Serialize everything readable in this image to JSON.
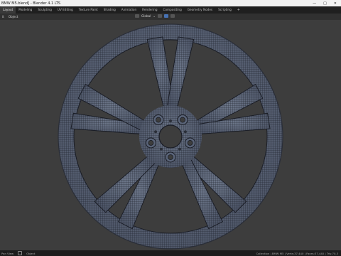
{
  "window": {
    "title": "BMW M5.blend] - Blender 4.1 LTS",
    "minimize": "—",
    "maximize": "□",
    "close": "✕"
  },
  "workspaces": {
    "tabs": [
      "Layout",
      "Modeling",
      "Sculpting",
      "UV Editing",
      "Texture Paint",
      "Shading",
      "Animation",
      "Rendering",
      "Compositing",
      "Geometry Nodes",
      "Scripting"
    ],
    "add": "+"
  },
  "scene": {
    "label": "Scene"
  },
  "header": {
    "menus": [
      "it",
      "Object"
    ],
    "transform": "Global",
    "pivot": "⌄"
  },
  "status": {
    "left": [
      "Pan View",
      "Object"
    ],
    "right": "Collection | BMW M5 | Verts:37,440 | Faces:37,440 | Tris:70,3"
  },
  "colors": {
    "viewport": "#3d3d3d",
    "wheel_fill": "#5a6478",
    "wire": "#1a1d26",
    "accent": "#4772b3"
  }
}
